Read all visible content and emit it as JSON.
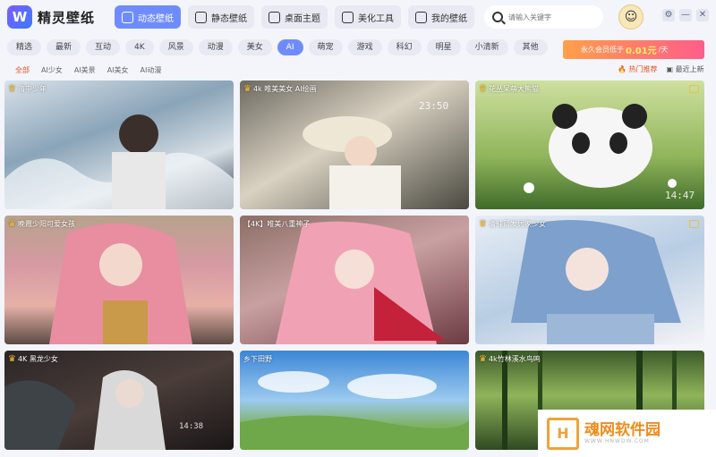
{
  "app": {
    "title": "精灵壁纸"
  },
  "nav": [
    {
      "label": "动态壁纸",
      "icon": "dynamic-wallpaper-icon"
    },
    {
      "label": "静态壁纸",
      "icon": "static-wallpaper-icon"
    },
    {
      "label": "桌面主题",
      "icon": "theme-icon"
    },
    {
      "label": "美化工具",
      "icon": "tools-icon"
    },
    {
      "label": "我的壁纸",
      "icon": "my-wallpaper-icon"
    }
  ],
  "search": {
    "placeholder": "请输入关键字"
  },
  "categories": [
    "精选",
    "最新",
    "互动",
    "4K",
    "风景",
    "动漫",
    "美女",
    "AI",
    "萌宠",
    "游戏",
    "科幻",
    "明星",
    "小清新",
    "其他"
  ],
  "active_category": "AI",
  "vip": {
    "prefix": "永久会员低于",
    "price": "0.01元",
    "suffix": "/天"
  },
  "subcategories": [
    "全部",
    "AI少女",
    "AI美景",
    "AI美女",
    "AI动漫"
  ],
  "active_subcategory": "全部",
  "sorts": {
    "hot": "热门推荐",
    "recent": "最近上新"
  },
  "cards": [
    {
      "title": "海中少年",
      "crown": true
    },
    {
      "title": "4k 唯美美女 AI绘画",
      "crown": true,
      "clock": "23:50"
    },
    {
      "title": "花丛呆萌大熊猫",
      "crown": true,
      "clock": "14:47"
    },
    {
      "title": "晚霞少阳可爱女孩",
      "crown": true
    },
    {
      "title": "【4K】唯美八重神子",
      "crown": false
    },
    {
      "title": "清纯蓝发居家少女",
      "crown": true
    },
    {
      "title": "4K 黑龙少女",
      "crown": true,
      "clock": "14:38"
    },
    {
      "title": "乡下田野",
      "crown": false
    },
    {
      "title": "4k竹林溪水鸟鸣",
      "crown": true
    }
  ],
  "watermark": {
    "text": "魂网软件园",
    "url": "WWW.HNWDW.COM"
  },
  "colors": {
    "accent": "#6f8cff",
    "hot": "#e8541e"
  }
}
